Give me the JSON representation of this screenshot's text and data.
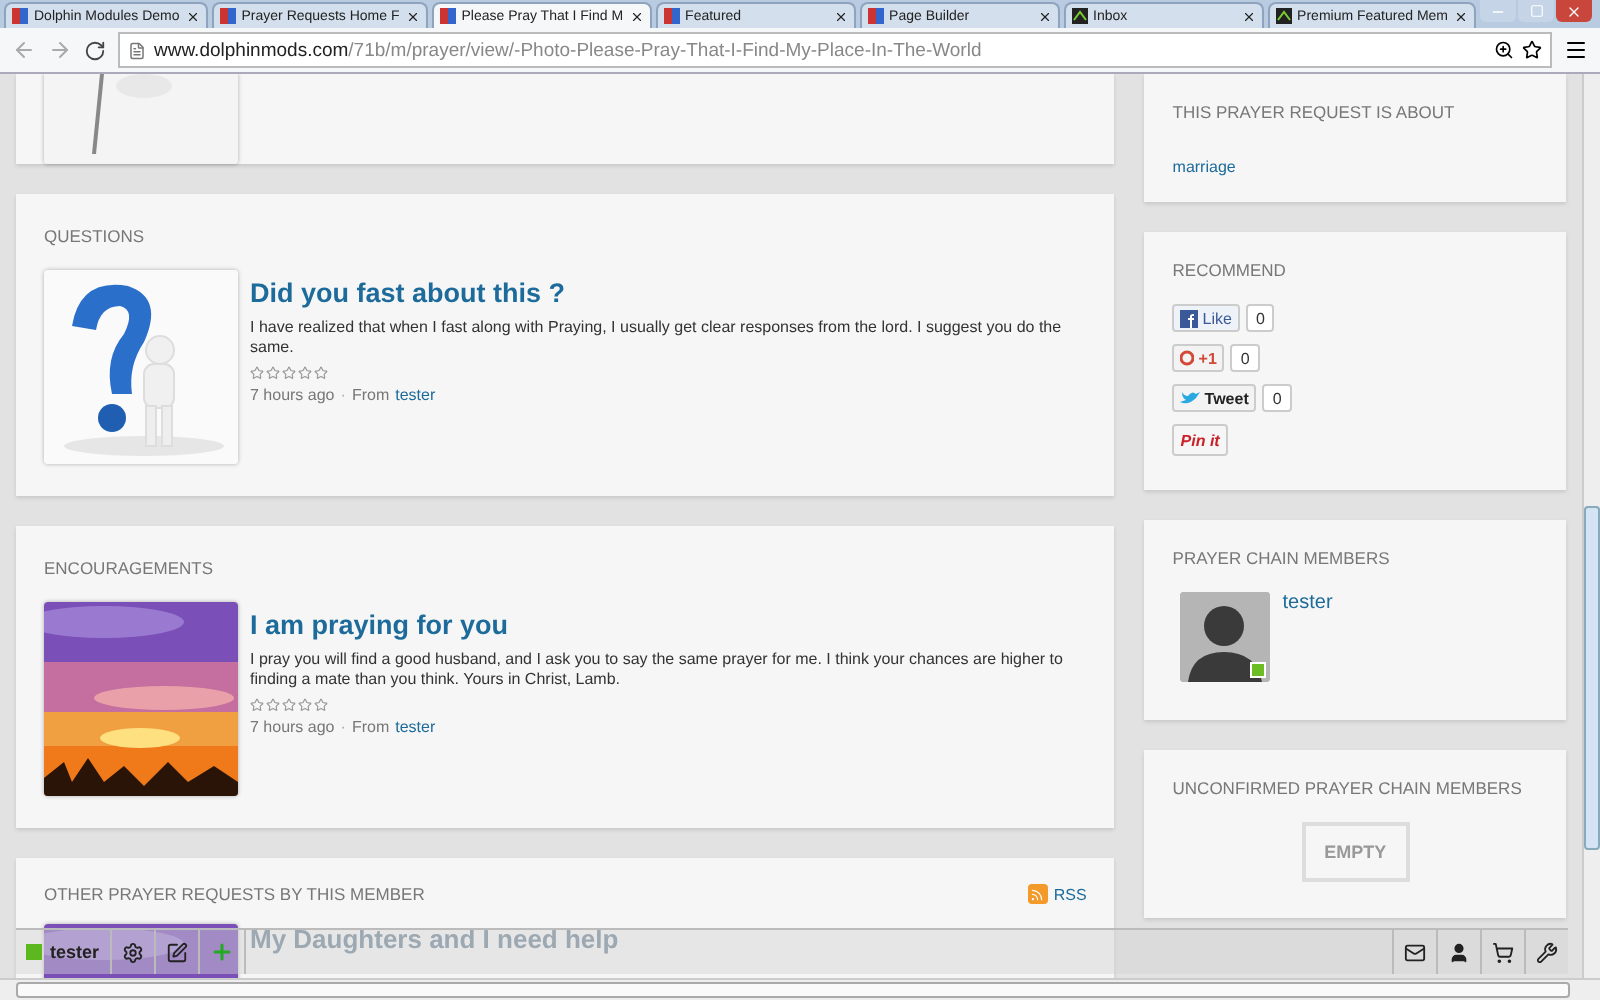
{
  "browser": {
    "tabs": [
      {
        "title": "Dolphin Modules Demo",
        "kind": "site",
        "selected": false
      },
      {
        "title": "Prayer Requests Home F",
        "kind": "site",
        "selected": false
      },
      {
        "title": "Please Pray That I Find M",
        "kind": "site",
        "selected": true
      },
      {
        "title": "Featured",
        "kind": "site",
        "selected": false
      },
      {
        "title": "Page Builder",
        "kind": "site",
        "selected": false
      },
      {
        "title": "Inbox",
        "kind": "dark",
        "selected": false
      },
      {
        "title": "Premium Featured Mem",
        "kind": "dark",
        "selected": false
      }
    ],
    "address": {
      "host": "www.dolphinmods.com",
      "path": "/71b/m/prayer/view/-Photo-Please-Pray-That-I-Find-My-Place-In-The-World"
    }
  },
  "main": [
    {
      "kind": "partial"
    },
    {
      "kind": "posts",
      "heading": "QUESTIONS",
      "posts": [
        {
          "title": "Did you fast about this ?",
          "body": "I have realized that when I fast along with Praying, I usually get clear responses from the lord. I suggest you do the same.",
          "stars": 0,
          "time": "7 hours ago",
          "separator": "·",
          "from": "From",
          "author": "tester"
        }
      ]
    },
    {
      "kind": "posts",
      "heading": "ENCOURAGEMENTS",
      "posts": [
        {
          "title": "I am praying for you",
          "body": "I pray you will find a good husband, and I ask you to say the same prayer for me. I think your chances are higher to finding a mate than you think. Yours in Christ, Lamb.",
          "stars": 0,
          "time": "7 hours ago",
          "separator": "·",
          "from": "From",
          "author": "tester"
        }
      ]
    },
    {
      "kind": "list",
      "heading": "OTHER PRAYER REQUESTS BY THIS MEMBER",
      "rss": "RSS",
      "items": [
        {
          "title": "My Daughters and I need help"
        }
      ]
    }
  ],
  "sidebar": [
    {
      "kind": "tags",
      "heading": "THIS PRAYER REQUEST IS ABOUT",
      "tags": [
        "marriage"
      ]
    },
    {
      "kind": "social",
      "heading": "RECOMMEND",
      "buttons": [
        {
          "kind": "facebook",
          "label": "Like",
          "count": "0"
        },
        {
          "kind": "gplus",
          "label": "+1",
          "count": "0"
        },
        {
          "kind": "twitter",
          "label": "Tweet",
          "count": "0"
        },
        {
          "kind": "pinterest",
          "label": "Pin it"
        }
      ]
    },
    {
      "kind": "members",
      "heading": "PRAYER CHAIN MEMBERS",
      "members": [
        {
          "name": "tester",
          "online": true
        }
      ]
    },
    {
      "kind": "empty",
      "heading": "UNCONFIRMED PRAYER CHAIN MEMBERS",
      "empty": "EMPTY"
    }
  ],
  "toolbar": {
    "user": "tester",
    "online": true
  }
}
